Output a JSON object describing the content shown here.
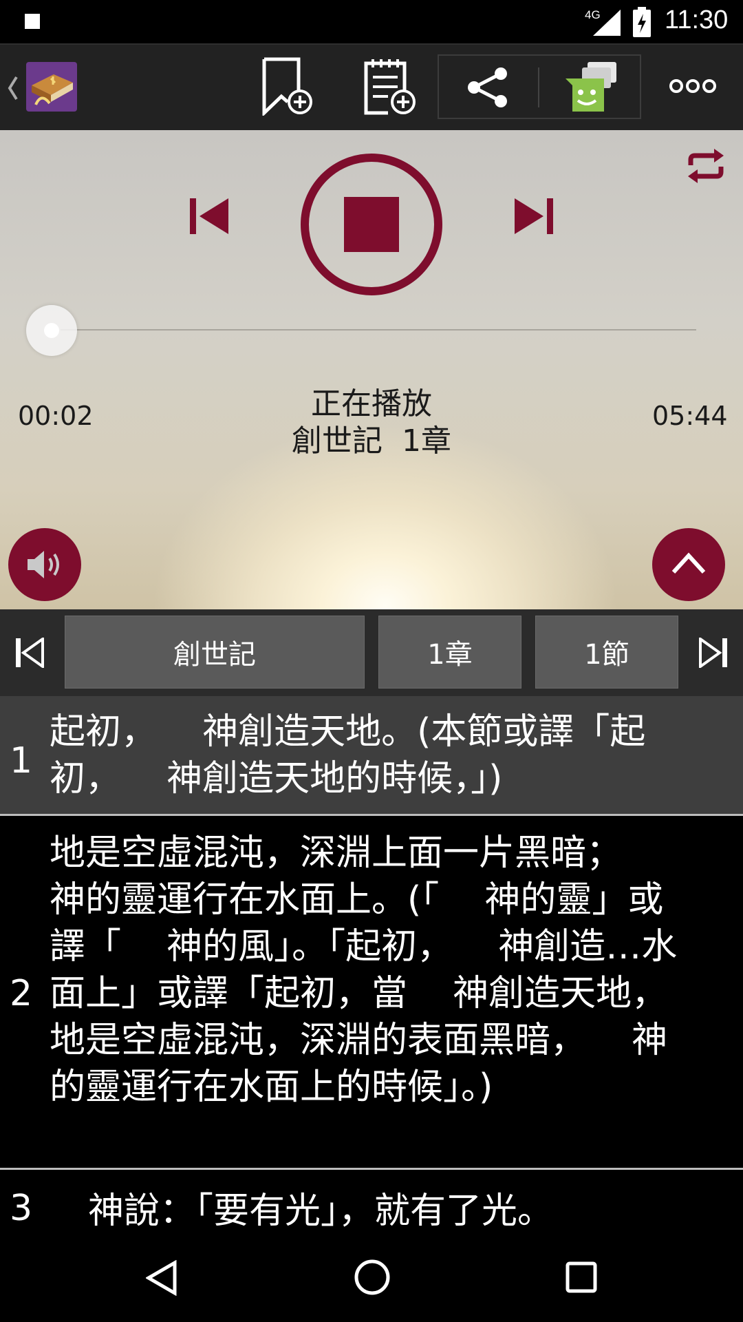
{
  "status_bar": {
    "network": "4G",
    "time": "11:30"
  },
  "toolbar": {
    "icons": [
      "back-chevron-icon",
      "bible-app-icon",
      "bookmark-add-icon",
      "note-add-icon",
      "share-icon",
      "messenger-icon",
      "more-icon"
    ]
  },
  "player": {
    "elapsed": "00:02",
    "total": "05:44",
    "progress": 0.006,
    "now_playing_label": "正在播放",
    "now_playing_title": "創世記  1章",
    "accent_color": "#7e0d2d"
  },
  "selector": {
    "book": "創世記",
    "chapter": "1章",
    "verse": "1節"
  },
  "verses": [
    {
      "num": "1",
      "text": "起初，    神創造天地。(本節或譯「起初，    神創造天地的時候，」)"
    },
    {
      "num": "2",
      "text": "地是空虛混沌，深淵上面一片黑暗；    神的靈運行在水面上。(「    神的靈」或譯「    神的風」。「起初，    神創造…水面上」或譯「起初，當    神創造天地，地是空虛混沌，深淵的表面黑暗，    神的靈運行在水面上的時候」。)"
    },
    {
      "num": "3",
      "text": "神說：「要有光」，就有了光。"
    }
  ]
}
